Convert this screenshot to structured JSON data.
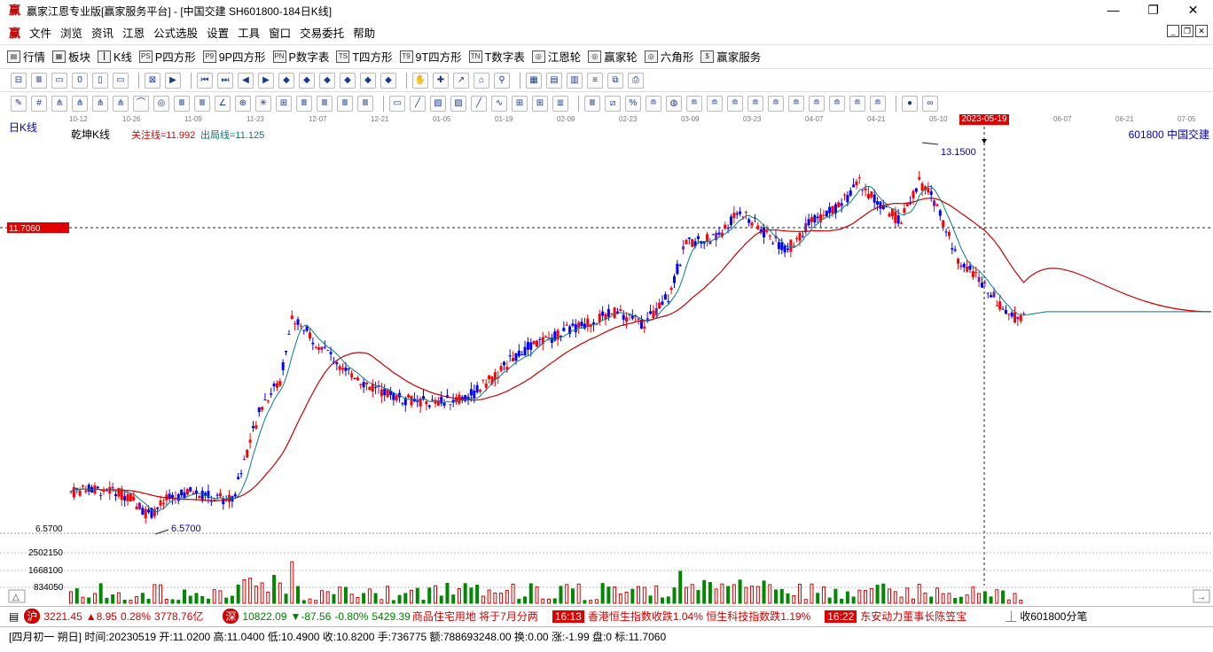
{
  "window": {
    "title": "赢家江恩专业版[赢家服务平台] - [中国交建  SH601800-184日K线]",
    "minimize_label": "—",
    "restore_label": "❐",
    "close_label": "✕"
  },
  "menu": {
    "logo": "赢",
    "items": [
      "文件",
      "浏览",
      "资讯",
      "江恩",
      "公式选股",
      "设置",
      "工具",
      "窗口",
      "交易委托",
      "帮助"
    ],
    "mdi_buttons": [
      "_",
      "❐",
      "✕"
    ]
  },
  "toolbar1": {
    "items": [
      {
        "icon": "grid-icon",
        "glyph": "▤",
        "label": "行情"
      },
      {
        "icon": "blocks-icon",
        "glyph": "▦",
        "label": "板块"
      },
      {
        "icon": "candles-icon",
        "glyph": "┃",
        "label": "K线"
      },
      {
        "icon": "ps-icon",
        "glyph": "PS",
        "label": "P四方形"
      },
      {
        "icon": "p9-icon",
        "glyph": "P9",
        "label": "9P四方形"
      },
      {
        "icon": "pn-icon",
        "glyph": "PN",
        "label": "P数字表"
      },
      {
        "icon": "ts-icon",
        "glyph": "TS",
        "label": "T四方形"
      },
      {
        "icon": "t9-icon",
        "glyph": "T9",
        "label": "9T四方形"
      },
      {
        "icon": "tn-icon",
        "glyph": "TN",
        "label": "T数字表"
      },
      {
        "icon": "wheel-icon",
        "glyph": "◎",
        "label": "江恩轮"
      },
      {
        "icon": "wheel2-icon",
        "glyph": "◎",
        "label": "赢家轮"
      },
      {
        "icon": "hexagon-icon",
        "glyph": "◎",
        "label": "六角形"
      },
      {
        "icon": "dollar-icon",
        "glyph": "$",
        "label": "赢家服务"
      }
    ]
  },
  "chart": {
    "period_label": "日K线",
    "indicator_name": "乾坤K线",
    "watch_line_text": "关注线=11.992",
    "exit_line_text": "出局线=11.125",
    "stock_label": "601800  中国交建",
    "price_tag": "11.7060",
    "high_label": "13.1500",
    "low_label": "6.5700",
    "low_axis_label": "6.5700",
    "selected_date": "2023-05-19",
    "date_ticks": [
      "10-12",
      "10-26",
      "11-09",
      "11-23",
      "12-07",
      "12-21",
      "01-05",
      "01-19",
      "02-09",
      "02-23",
      "03-09",
      "03-23",
      "04-07",
      "04-21",
      "05-10",
      "06-07",
      "06-21",
      "07-05"
    ],
    "volume_axis_labels": [
      "2502150",
      "1668100",
      "834050"
    ],
    "colors": {
      "up": "#ff0000",
      "down": "#0000ff",
      "special": "#7b1fa2",
      "ma_short": "#0a7b83",
      "ma_long": "#cc0000",
      "vol_up": "#d40000",
      "vol_down": "#008800"
    }
  },
  "chart_data": {
    "type": "candlestick",
    "ylim": [
      6.57,
      13.15
    ],
    "price_marks": {
      "watch_line": 11.992,
      "exit_line": 11.125,
      "current_level": 11.706,
      "high": 13.15,
      "low": 6.57
    }
  },
  "status1": {
    "sh_index": "3221.45",
    "sh_change": "▲8.95",
    "sh_pct": "0.28%",
    "sh_amount": "3778.76亿",
    "hk_index": "10822.09",
    "hk_change": "▼-87.56",
    "hk_pct": "-0.80%",
    "hk_amount": "5429.39",
    "news1": "商品住宅用地 将于7月分两",
    "time1": "16:13",
    "news2": "香港恒生指数收跌1.04% 恒生科技指数跌1.19%",
    "time2": "16:22",
    "news3": "东安动力董事长陈笠宝",
    "close_label": "收601800分笔"
  },
  "status2": {
    "text": "[四月初一  朔日] 时间:20230519 开:11.0200 高:11.0400 低:10.4900 收:10.8200 手:736775 额:788693248.00 换:0.00 涨:-1.99 盘:0 标:11.7060"
  }
}
